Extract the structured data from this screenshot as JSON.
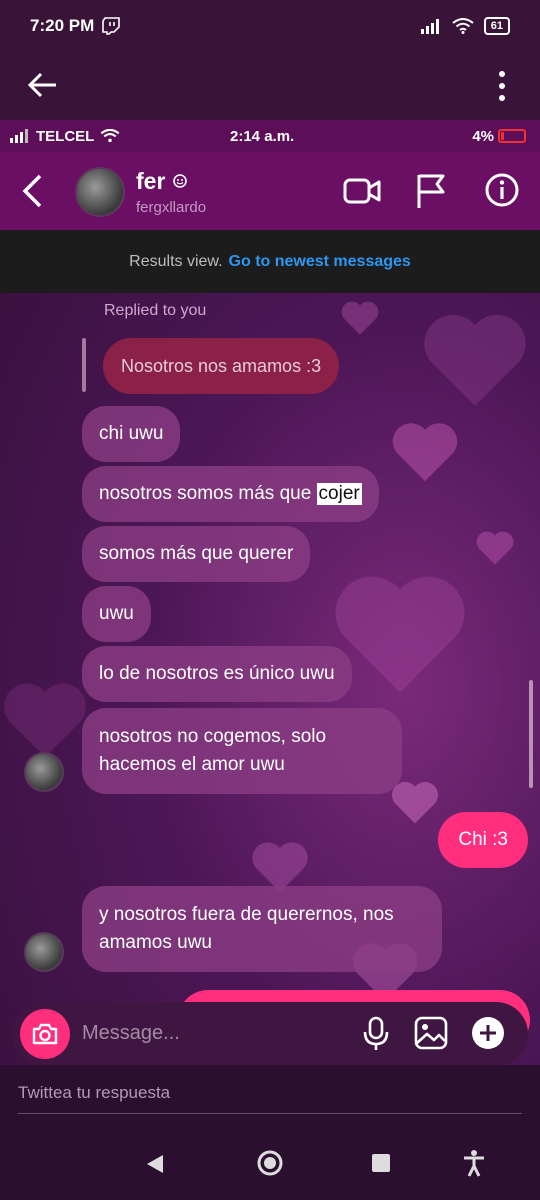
{
  "outer_status": {
    "time": "7:20 PM",
    "battery": "61"
  },
  "inner_status": {
    "carrier": "TELCEL",
    "time": "2:14 a.m.",
    "battery": "4%"
  },
  "chat_header": {
    "name": "fer",
    "username": "fergxllardo"
  },
  "results_bar": {
    "label": "Results view.",
    "link": "Go to newest messages"
  },
  "reply": {
    "label": "Replied to you",
    "quote": "Nosotros nos amamos :3"
  },
  "messages": [
    {
      "text": "chi uwu"
    },
    {
      "text_before": "nosotros somos más que ",
      "highlight": "cojer"
    },
    {
      "text": "somos más que querer"
    },
    {
      "text": "uwu"
    },
    {
      "text": "lo de nosotros es único uwu"
    },
    {
      "text": "nosotros no cogemos, solo hacemos el amor uwu"
    },
    {
      "text": "Chi :3"
    },
    {
      "text": "y nosotros fuera de querernos, nos amamos uwu"
    }
  ],
  "composer": {
    "placeholder": "Message..."
  },
  "twitter_reply": {
    "placeholder": "Twittea tu respuesta"
  },
  "colors": {
    "accent": "#ff2f7d",
    "header": "#6a0f64",
    "link": "#2c96f0"
  }
}
